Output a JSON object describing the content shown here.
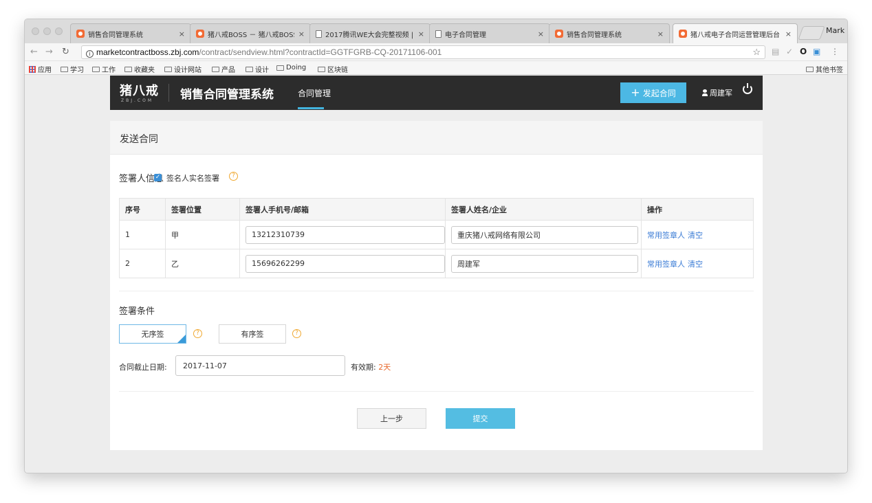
{
  "browser": {
    "tabs": [
      {
        "label": "销售合同管理系统",
        "icon": "zbj-favicon",
        "active": false
      },
      {
        "label": "猪八戒BOSS － 猪八戒BOSS",
        "icon": "zbj-favicon",
        "active": false
      },
      {
        "label": "2017腾讯WE大会完整视频 | ",
        "icon": "page-icon",
        "active": false
      },
      {
        "label": "电子合同管理",
        "icon": "page-icon",
        "active": false
      },
      {
        "label": "销售合同管理系统",
        "icon": "zbj-favicon",
        "active": false
      },
      {
        "label": "猪八戒电子合同运营管理后台",
        "icon": "zbj-favicon",
        "active": true
      }
    ],
    "profile_name": "Mark",
    "url_host": "marketcontractboss.zbj.com",
    "url_rest": "/contract/sendview.html?contractId=GGTFGRB-CQ-20171106-001",
    "bookmarks": [
      "应用",
      "学习",
      "工作",
      "收藏夹",
      "设计网站",
      "产品",
      "设计",
      "Doing",
      "区块链"
    ],
    "other_bookmarks": "其他书签"
  },
  "app": {
    "logo_text": "猪八戒",
    "logo_sub": "ZBJ.COM",
    "system_title": "销售合同管理系统",
    "nav_item": "合同管理",
    "launch_label": "发起合同",
    "user_name": "周建军"
  },
  "form": {
    "title": "发送合同",
    "signer_section": "签署人信息",
    "realname_label": "签名人实名签署",
    "realname_checked": true,
    "columns": [
      "序号",
      "签署位置",
      "签署人手机号/邮箱",
      "签署人姓名/企业",
      "操作"
    ],
    "rows": [
      {
        "index": "1",
        "position": "甲",
        "contact": "13212310739",
        "name": "重庆猪八戒网络有限公司",
        "action_common": "常用签章人",
        "action_clear": "清空"
      },
      {
        "index": "2",
        "position": "乙",
        "contact": "15696262299",
        "name": "周建军",
        "action_common": "常用签章人",
        "action_clear": "清空"
      }
    ],
    "condition_section": "签署条件",
    "order_options": [
      {
        "label": "无序签",
        "selected": true
      },
      {
        "label": "有序签",
        "selected": false
      }
    ],
    "deadline_label": "合同截止日期:",
    "deadline_value": "2017-11-07",
    "validity_label": "有效期:",
    "validity_value": "2天",
    "prev_label": "上一步",
    "submit_label": "提交"
  },
  "colors": {
    "topnav_bg": "#2c2c2c",
    "accent": "#4cb8e4",
    "link": "#3a7bd5",
    "help": "#f0a830",
    "highlight": "#e8692c"
  }
}
